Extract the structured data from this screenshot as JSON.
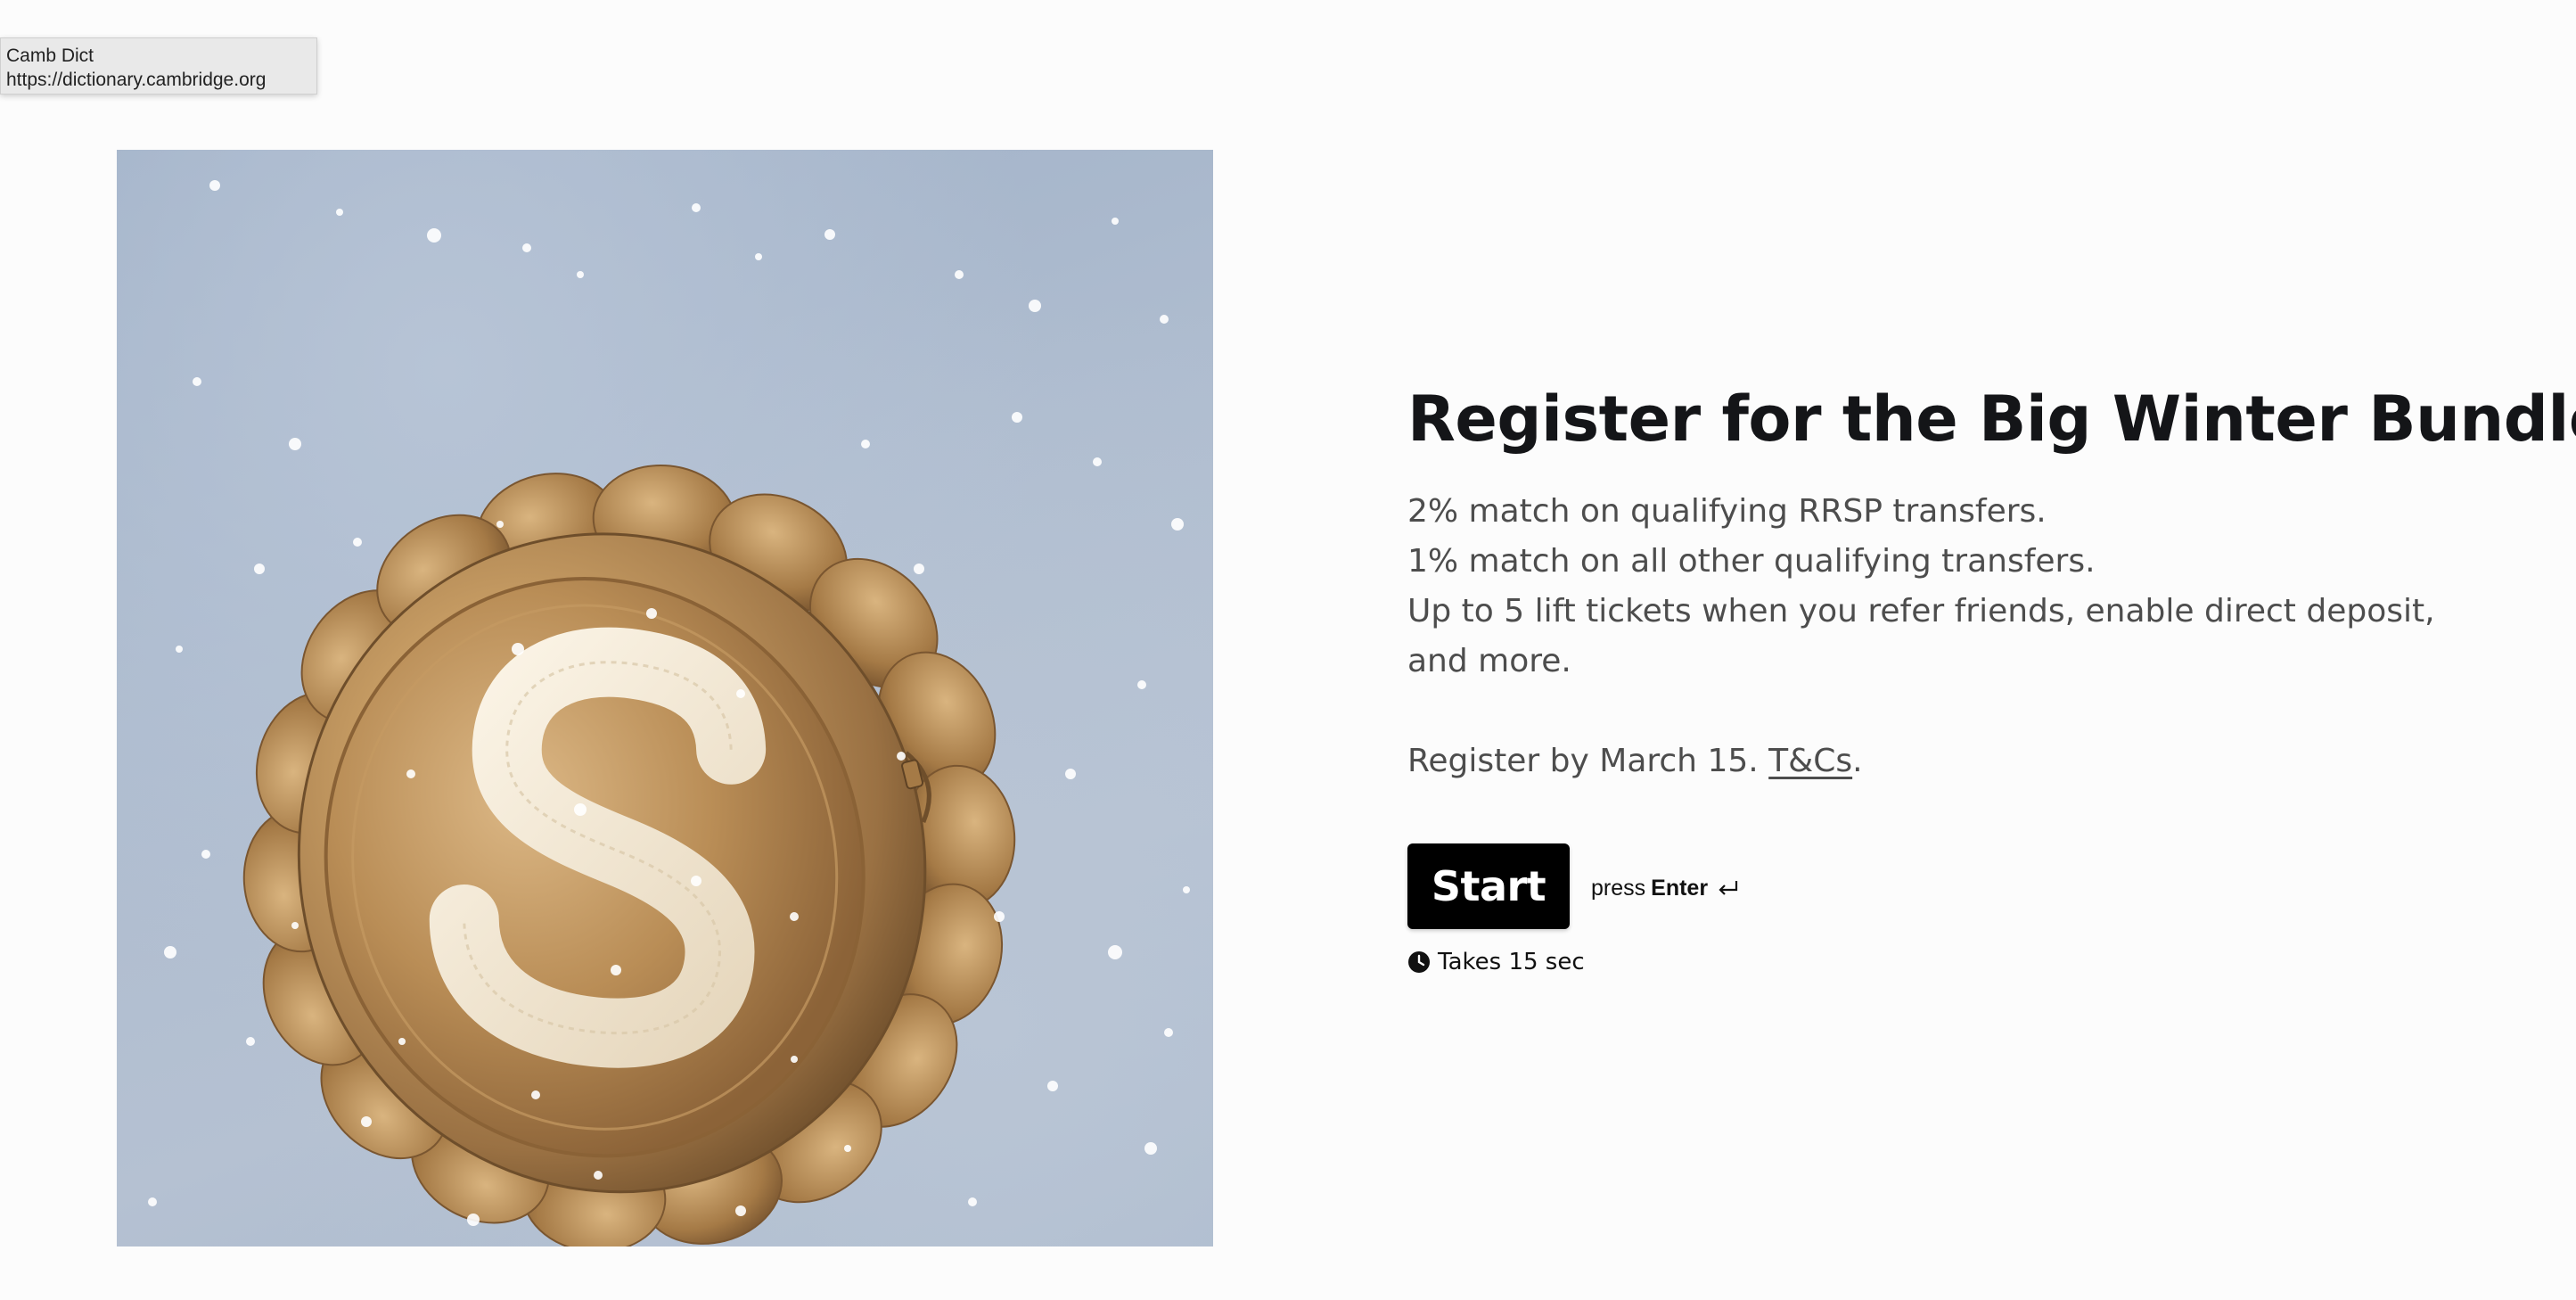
{
  "tooltip": {
    "title": "Camb Dict",
    "url": "https://dictionary.cambridge.org"
  },
  "hero": {
    "image_alt": "Inflatable gold coin with dollar sign floating in snowy sky",
    "icons": [
      "dollar-sign-icon"
    ]
  },
  "content": {
    "title": "Register for the Big Winter Bundle",
    "lines": [
      "2% match on qualifying RRSP transfers.",
      "1% match on all other qualifying transfers.",
      "Up to 5 lift tickets when you refer friends, enable direct deposit, and more."
    ],
    "deadline_prefix": "Register by March 15.",
    "tcs_label": "T&Cs",
    "deadline_suffix": "."
  },
  "actions": {
    "start_label": "Start",
    "hint_prefix": "press",
    "hint_key": "Enter",
    "enter_icon": "return-arrow-icon",
    "duration_icon": "clock-icon",
    "duration": "Takes 15 sec"
  },
  "colors": {
    "background": "#fcfcfc",
    "title": "#141518",
    "body_text": "#4d4d4d",
    "button_bg": "#000000",
    "button_text": "#ffffff",
    "coin_gold": "#b8905a",
    "sky": "#aebccf"
  }
}
